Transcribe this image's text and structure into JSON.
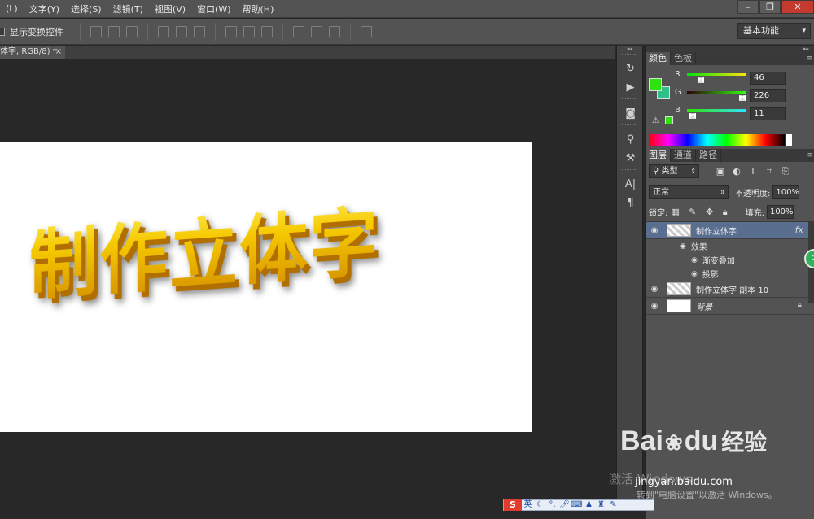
{
  "menubar": {
    "items": [
      "(L)",
      "文字(Y)",
      "选择(S)",
      "滤镜(T)",
      "视图(V)",
      "窗口(W)",
      "帮助(H)"
    ],
    "window_controls": [
      "–",
      "❐",
      "✕"
    ]
  },
  "options": {
    "show_transform_label": "显示变换控件",
    "workspace": "基本功能"
  },
  "document": {
    "tab_label": "体字, RGB/8) *",
    "tab_close": "×",
    "canvas_text": "制作立体字",
    "canvas_text_color": "#f2b400"
  },
  "color_panel": {
    "tabs": [
      "颜色",
      "色板"
    ],
    "foreground": "#2ee20b",
    "background": "#2fbf8a",
    "channels": [
      {
        "label": "R",
        "value": "46",
        "track": "linear-gradient(90deg,#00e20b,#ffe20b)",
        "level": 0.18
      },
      {
        "label": "G",
        "value": "226",
        "track": "linear-gradient(90deg,#2e000b,#2eff0b)",
        "level": 0.89
      },
      {
        "label": "B",
        "value": "11",
        "track": "linear-gradient(90deg,#2ee200,#2ee2ff)",
        "level": 0.04
      }
    ]
  },
  "layers_panel": {
    "tabs": [
      "图层",
      "通道",
      "路径"
    ],
    "filter_type": "类型",
    "blend_mode": "正常",
    "opacity_label": "不透明度:",
    "opacity": "100%",
    "lock_label": "锁定:",
    "fill_label": "填充:",
    "fill": "100%",
    "layers": [
      {
        "name": "制作立体字",
        "fx": "fx",
        "selected": true
      },
      {
        "name": "制作立体字 副本 10",
        "selected": false
      },
      {
        "name": "背景",
        "locked": true,
        "selected": false
      }
    ],
    "effects_label": "效果",
    "effects": [
      "渐变叠加",
      "投影"
    ]
  },
  "overlay": {
    "baidu_logo": "Bai",
    "baidu_logo_du": "du",
    "baidu_cn": "经验",
    "baidu_url": "jingyan.baidu.com",
    "activate_title": "激活 Windows",
    "activate_hint": "转到\"电脑设置\"以激活 Windows。"
  },
  "ime": {
    "logo": "S",
    "mode": "英"
  }
}
